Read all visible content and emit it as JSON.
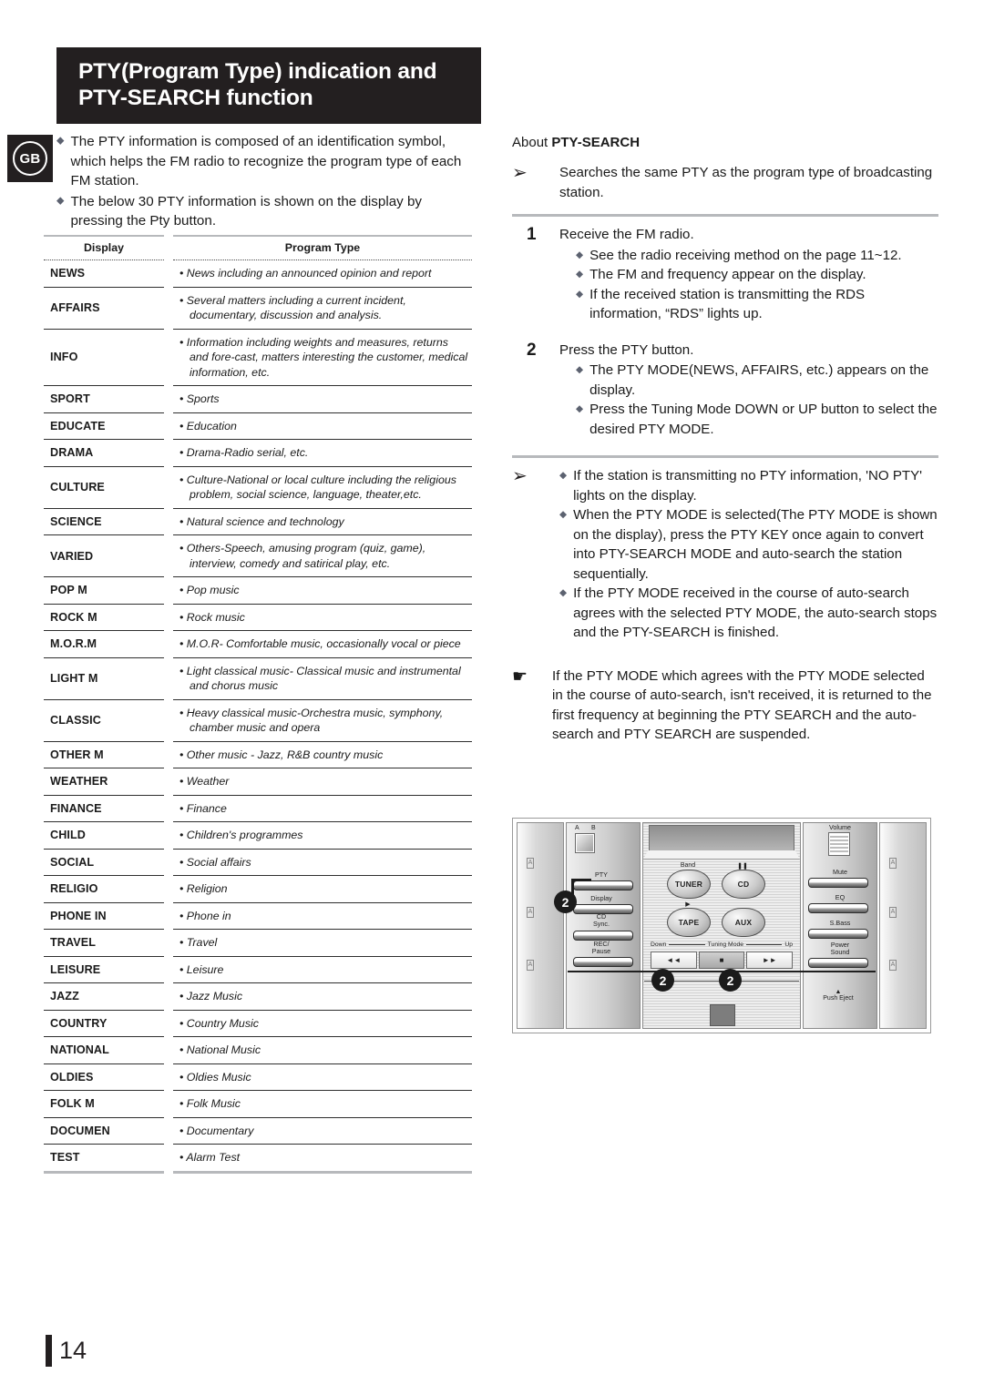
{
  "language_badge": "GB",
  "page_number": "14",
  "title": {
    "line1": "PTY(Program Type) indication and",
    "line2": "PTY-SEARCH function"
  },
  "intro": {
    "bullets": [
      "The PTY information is composed of an identification symbol, which helps the FM radio to recognize the program type of each FM station.",
      "The below 30 PTY information is shown on the display by pressing the Pty button."
    ]
  },
  "table": {
    "headers": {
      "display": "Display",
      "program_type": "Program Type"
    },
    "rows": [
      {
        "display": "NEWS",
        "type": "• News including an announced opinion and report"
      },
      {
        "display": "AFFAIRS",
        "type": "• Several matters including a current incident, documentary, discussion and analysis."
      },
      {
        "display": "INFO",
        "type": "•  Information including weights and measures, returns and fore-cast, matters interesting the customer, medical information, etc."
      },
      {
        "display": "SPORT",
        "type": "• Sports"
      },
      {
        "display": "EDUCATE",
        "type": "• Education"
      },
      {
        "display": "DRAMA",
        "type": "• Drama-Radio serial, etc."
      },
      {
        "display": "CULTURE",
        "type": "• Culture-National or local culture including the religious problem, social science, language, theater,etc."
      },
      {
        "display": "SCIENCE",
        "type": "• Natural science and technology"
      },
      {
        "display": "VARIED",
        "type": "• Others-Speech, amusing program (quiz, game), interview, comedy and satirical play, etc."
      },
      {
        "display": "POP M",
        "type": "• Pop music"
      },
      {
        "display": "ROCK M",
        "type": "• Rock music"
      },
      {
        "display": "M.O.R.M",
        "type": "• M.O.R- Comfortable music, occasionally vocal or piece"
      },
      {
        "display": "LIGHT M",
        "type": "• Light classical music- Classical music and instrumental and chorus music"
      },
      {
        "display": "CLASSIC",
        "type": "• Heavy classical  music-Orchestra music, symphony, chamber music and opera"
      },
      {
        "display": "OTHER M",
        "type": "• Other music - Jazz, R&B country music"
      },
      {
        "display": "WEATHER",
        "type": "• Weather"
      },
      {
        "display": "FINANCE",
        "type": "• Finance"
      },
      {
        "display": "CHILD",
        "type": "• Children's programmes"
      },
      {
        "display": "SOCIAL",
        "type": "• Social affairs"
      },
      {
        "display": "RELIGIO",
        "type": "• Religion"
      },
      {
        "display": "PHONE IN",
        "type": "• Phone in"
      },
      {
        "display": "TRAVEL",
        "type": "• Travel"
      },
      {
        "display": "LEISURE",
        "type": "• Leisure"
      },
      {
        "display": "JAZZ",
        "type": "• Jazz Music"
      },
      {
        "display": "COUNTRY",
        "type": "• Country Music"
      },
      {
        "display": "NATIONAL",
        "type": "• National Music"
      },
      {
        "display": "OLDIES",
        "type": "• Oldies Music"
      },
      {
        "display": "FOLK M",
        "type": "• Folk Music"
      },
      {
        "display": "DOCUMEN",
        "type": "• Documentary"
      },
      {
        "display": "TEST",
        "type": "• Alarm Test"
      }
    ]
  },
  "about": {
    "heading_bold": "About ",
    "heading_rest": "PTY-SEARCH",
    "summary": "Searches the same PTY as the program type of broadcasting station.",
    "step1": {
      "number": "1",
      "lead": "Receive the FM radio.",
      "bullets": [
        "See the radio receiving method on the page 11~12.",
        "The FM and frequency appear on the display.",
        "If the received station is transmitting the RDS information, “RDS” lights up."
      ]
    },
    "step2": {
      "number": "2",
      "lead": "Press the PTY button.",
      "bullets": [
        "The PTY MODE(NEWS, AFFAIRS, etc.) appears on the display.",
        "Press the Tuning Mode DOWN or UP button to select the desired PTY MODE."
      ]
    },
    "notes": [
      "If the station is transmitting no PTY information, 'NO PTY' lights on the display.",
      "When the PTY MODE is selected(The PTY MODE is shown on the display), press the PTY KEY once again to convert into PTY-SEARCH MODE and auto-search the station sequentially.",
      "If the PTY MODE received in the course of auto-search agrees with the selected PTY MODE, the auto-search stops and the PTY-SEARCH is finished."
    ],
    "hand_note": "If the PTY MODE which agrees with the PTY MODE selected in the course of auto-search, isn't received, it is returned to the first frequency at beginning the PTY SEARCH and the auto-search and PTY SEARCH are suspended."
  },
  "device": {
    "labels": {
      "a": "A",
      "b": "B",
      "pty": "PTY",
      "display": "Display",
      "cd_sync": "CD\nSync.",
      "rec_pause": "REC/\nPause",
      "band": "Band",
      "tuner": "TUNER",
      "cd": "CD",
      "tape": "TAPE",
      "aux": "AUX",
      "cd_icon": "❚❚",
      "tape_icon": "▶",
      "down": "Down",
      "tuning_mode": "Tuning Mode",
      "up": "Up",
      "btn_prev": "◄◄",
      "btn_stop": "■",
      "btn_next": "►►",
      "volume": "Volume",
      "mute": "Mute",
      "eq": "EQ",
      "s_bass": "S.Bass",
      "power_sound": "Power\nSound",
      "push_eject": "Push Eject"
    },
    "callouts": [
      "2",
      "2",
      "2"
    ]
  }
}
